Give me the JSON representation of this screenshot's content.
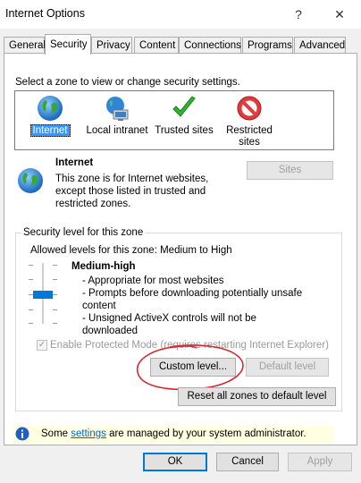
{
  "window": {
    "title": "Internet Options",
    "help": "?",
    "close": "✕"
  },
  "tabs": [
    "General",
    "Security",
    "Privacy",
    "Content",
    "Connections",
    "Programs",
    "Advanced"
  ],
  "active_tab": "Security",
  "security": {
    "select_prompt": "Select a zone to view or change security settings.",
    "zones": [
      {
        "name": "Internet",
        "icon": "globe-icon",
        "selected": true
      },
      {
        "name": "Local intranet",
        "icon": "intranet-icon",
        "selected": false
      },
      {
        "name": "Trusted sites",
        "icon": "checkmark-icon",
        "selected": false
      },
      {
        "name": "Restricted sites",
        "icon": "restricted-icon",
        "selected": false
      }
    ],
    "zone_info": {
      "title": "Internet",
      "description": "This zone is for Internet websites, except those listed in trusted and restricted zones."
    },
    "sites_button": "Sites",
    "level_group": {
      "title": "Security level for this zone",
      "allowed": "Allowed levels for this zone: Medium to High",
      "level_name": "Medium-high",
      "bullets": [
        "- Appropriate for most websites",
        "- Prompts before downloading potentially unsafe content",
        "- Unsigned ActiveX controls will not be downloaded"
      ],
      "protected_mode": "Enable Protected Mode (requires restarting Internet Explorer)",
      "protected_checked": true,
      "custom_level": "Custom level...",
      "default_level": "Default level",
      "reset_all": "Reset all zones to default level"
    },
    "info": {
      "prefix": "Some ",
      "link": "settings",
      "suffix": " are managed by your system administrator."
    }
  },
  "footer": {
    "ok": "OK",
    "cancel": "Cancel",
    "apply": "Apply"
  },
  "colors": {
    "selection": "#3399ff",
    "annotation_circle": "#d9262d",
    "info_bg": "#ffffe1"
  }
}
